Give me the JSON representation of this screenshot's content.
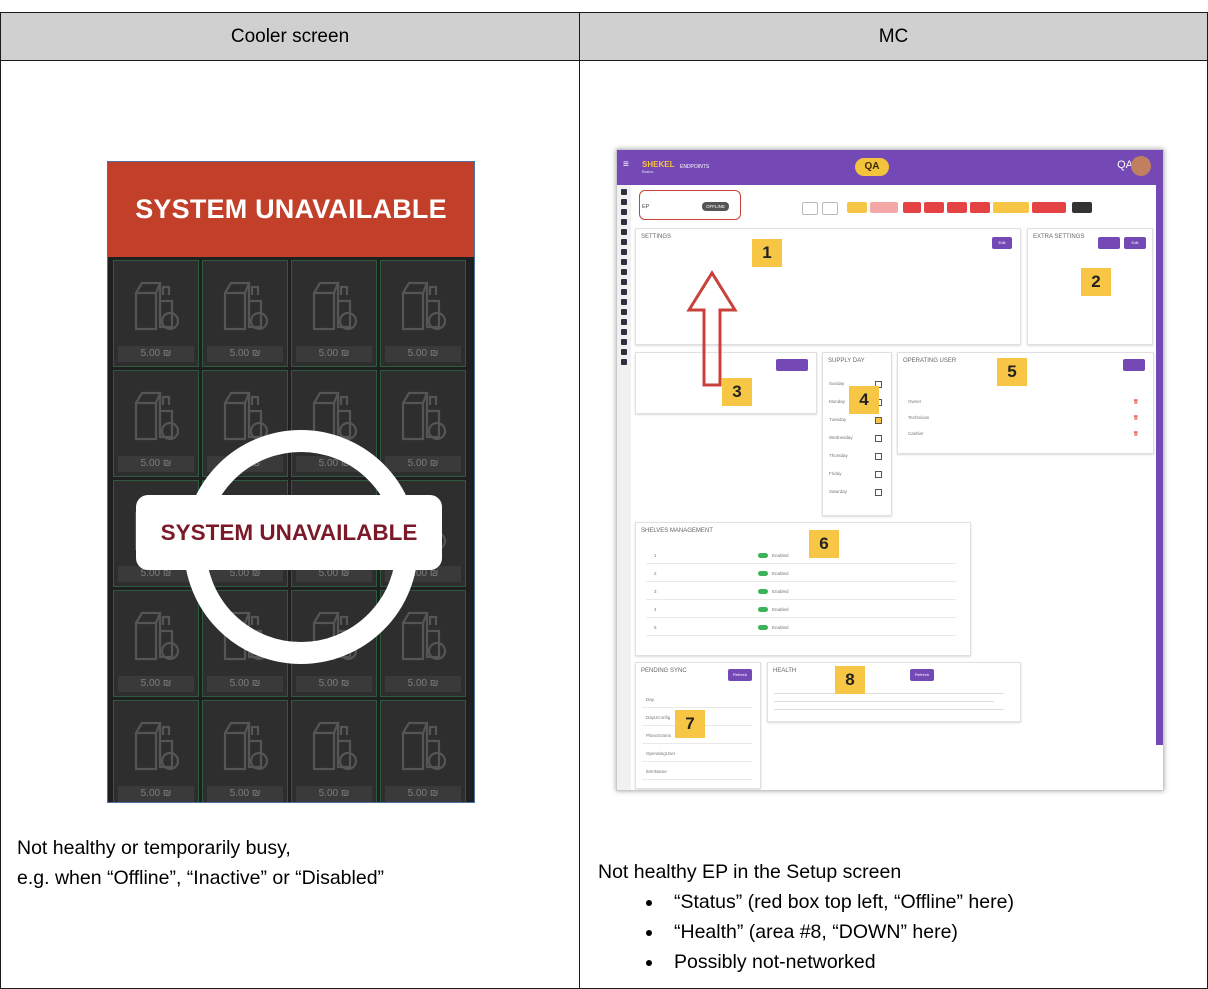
{
  "header": {
    "left": "Cooler screen",
    "right": "MC"
  },
  "cooler": {
    "banner": "SYSTEM UNAVAILABLE",
    "overlay": "SYSTEM UNAVAILABLE",
    "price": "5.00 ₪"
  },
  "left_note": {
    "line1": "Not healthy or temporarily busy,",
    "line2": "e.g. when “Offline”, “Inactive” or “Disabled”"
  },
  "right_note": {
    "intro": "Not healthy EP in the Setup screen",
    "bullets": [
      "“Status” (red box top left, “Offline” here)",
      "“Health” (area #8, “DOWN” here)",
      "Possibly not-networked"
    ]
  },
  "mc": {
    "logo": "SHEKEL",
    "logo_sub": "Brains",
    "section": "ENDPOINTS",
    "env": "QA",
    "user": "QA",
    "status": "OFFLINE",
    "settings_title": "SETTINGS",
    "extra_settings_title": "EXTRA SETTINGS",
    "operating_users_title": "OPERATING USER",
    "supply_day_title": "SUPPLY DAY",
    "shelves_title": "SHELVES MANAGEMENT",
    "pending_sync_title": "PENDING SYNC",
    "health_title": "HEALTH",
    "area_numbers": [
      "1",
      "2",
      "3",
      "4",
      "5",
      "6",
      "7",
      "8"
    ],
    "days": [
      "Sunday",
      "Monday",
      "Tuesday",
      "Wednesday",
      "Thursday",
      "Friday",
      "Saturday"
    ],
    "shelves": [
      "1",
      "2",
      "3",
      "4",
      "5"
    ],
    "shelf_status": "Enabled",
    "pending_types": [
      "Day",
      "DayUConfig",
      "PlanoGrams",
      "OperatingUser",
      "ItemName"
    ],
    "user_types": [
      "Owner",
      "Technician",
      "Cashier"
    ],
    "refresh_label": "Refresh",
    "edit_label": "Edit"
  }
}
